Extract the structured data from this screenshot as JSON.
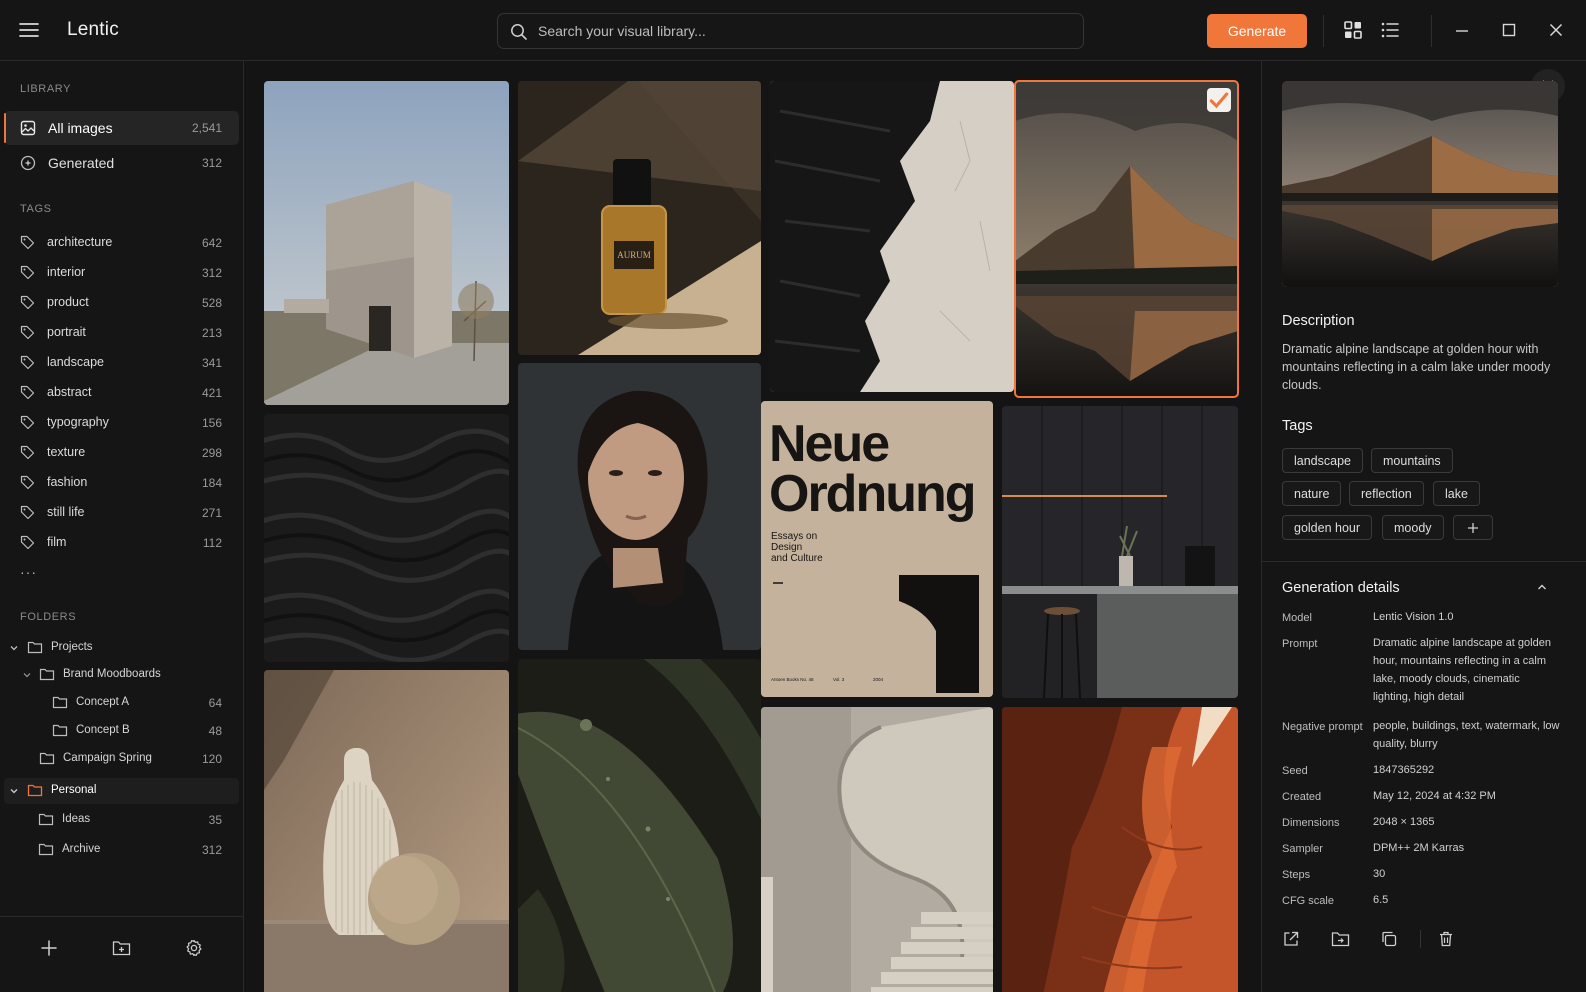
{
  "app": {
    "title": "Lentic"
  },
  "search": {
    "placeholder": "Search your visual library..."
  },
  "toolbar": {
    "generate_label": "Generate",
    "icons": [
      "grid-view-icon",
      "list-view-icon",
      "minimize-icon",
      "maximize-icon",
      "close-icon"
    ]
  },
  "sidebar": {
    "library_label": "LIBRARY",
    "library_items": [
      {
        "label": "All images",
        "count": "2,541",
        "icon": "image-icon",
        "active": true
      },
      {
        "label": "Generated",
        "count": "312",
        "icon": "sparkle-icon",
        "active": false
      }
    ],
    "tags_label": "TAGS",
    "tags": [
      {
        "label": "architecture",
        "count": "642"
      },
      {
        "label": "interior",
        "count": "312"
      },
      {
        "label": "product",
        "count": "528"
      },
      {
        "label": "portrait",
        "count": "213"
      },
      {
        "label": "landscape",
        "count": "341"
      },
      {
        "label": "abstract",
        "count": "421"
      },
      {
        "label": "typography",
        "count": "156"
      },
      {
        "label": "texture",
        "count": "298"
      },
      {
        "label": "fashion",
        "count": "184"
      },
      {
        "label": "still life",
        "count": "271"
      },
      {
        "label": "film",
        "count": "112"
      }
    ],
    "more_label": "···",
    "folders_label": "FOLDERS",
    "folders": [
      {
        "label": "Projects",
        "count": ""
      },
      {
        "label": "Brand Moodboards",
        "count": ""
      },
      {
        "label": "Concept A",
        "count": "64"
      },
      {
        "label": "Concept B",
        "count": "48"
      },
      {
        "label": "Campaign Spring",
        "count": "120"
      },
      {
        "label": "Personal",
        "count": ""
      },
      {
        "label": "Ideas",
        "count": "35"
      },
      {
        "label": "Archive",
        "count": "312"
      }
    ]
  },
  "gallery": {
    "tiles": [
      {
        "name": "architecture-image"
      },
      {
        "name": "perfume-image",
        "bottle_label": "AURUM"
      },
      {
        "name": "texture-image"
      },
      {
        "name": "mountain-lake-image",
        "selected": true
      },
      {
        "name": "dark-waves-image"
      },
      {
        "name": "portrait-image"
      },
      {
        "name": "poster-image",
        "title_line1": "Neue",
        "title_line2": "Ordnung",
        "subtitle": [
          "Essays on",
          "Design",
          "and Culture"
        ],
        "footer": [
          "Antoen Books No. 48",
          "Vol. 3",
          "2004"
        ]
      },
      {
        "name": "kitchen-image"
      },
      {
        "name": "vase-image"
      },
      {
        "name": "leaf-image"
      },
      {
        "name": "staircase-image"
      },
      {
        "name": "canyon-image"
      }
    ]
  },
  "detail": {
    "description_heading": "Description",
    "description": "Dramatic alpine landscape at golden hour with mountains reflecting in a calm lake under moody clouds.",
    "tags_heading": "Tags",
    "tags": [
      "landscape",
      "mountains",
      "nature",
      "reflection",
      "lake",
      "golden hour",
      "moody"
    ],
    "generation_heading": "Generation details",
    "meta": [
      {
        "key": "Model",
        "value": "Lentic Vision 1.0"
      },
      {
        "key": "Prompt",
        "value": "Dramatic alpine landscape at golden hour, mountains reflecting in a calm lake, moody clouds, cinematic lighting, high detail"
      },
      {
        "key": "Negative prompt",
        "value": "people, buildings, text, watermark, low quality, blurry"
      },
      {
        "key": "Seed",
        "value": "1847365292"
      },
      {
        "key": "Created",
        "value": "May 12, 2024 at 4:32 PM"
      },
      {
        "key": "Dimensions",
        "value": "2048 × 1365"
      },
      {
        "key": "Sampler",
        "value": "DPM++ 2M Karras"
      },
      {
        "key": "Steps",
        "value": "30"
      },
      {
        "key": "CFG scale",
        "value": "6.5"
      }
    ]
  },
  "colors": {
    "accent": "#f0763a",
    "background": "#141414"
  }
}
